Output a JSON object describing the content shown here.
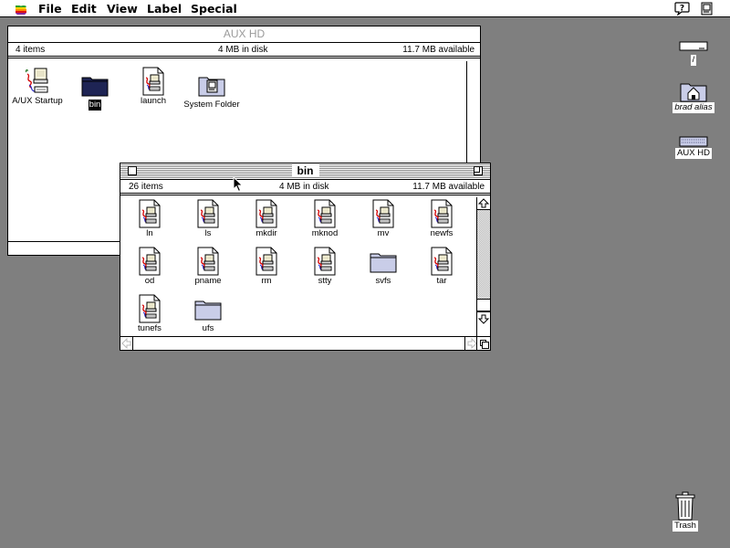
{
  "menubar": {
    "items": [
      "File",
      "Edit",
      "View",
      "Label",
      "Special"
    ]
  },
  "aux_window": {
    "title": "AUX HD",
    "items_count": "4 items",
    "disk_usage": "4 MB in disk",
    "available": "11.7 MB available",
    "icons": [
      {
        "label": "A/UX Startup",
        "icon": "application-icon",
        "selected": false
      },
      {
        "label": "bin",
        "icon": "folder-icon",
        "selected": true
      },
      {
        "label": "launch",
        "icon": "document-icon",
        "selected": false
      },
      {
        "label": "System Folder",
        "icon": "system-folder-icon",
        "selected": false
      }
    ]
  },
  "bin_window": {
    "title": "bin",
    "items_count": "26 items",
    "disk_usage": "4 MB in disk",
    "available": "11.7 MB available",
    "icons": [
      {
        "label": "ln",
        "icon": "document-icon"
      },
      {
        "label": "ls",
        "icon": "document-icon"
      },
      {
        "label": "mkdir",
        "icon": "document-icon"
      },
      {
        "label": "mknod",
        "icon": "document-icon"
      },
      {
        "label": "mv",
        "icon": "document-icon"
      },
      {
        "label": "newfs",
        "icon": "document-icon"
      },
      {
        "label": "od",
        "icon": "document-icon"
      },
      {
        "label": "pname",
        "icon": "document-icon"
      },
      {
        "label": "rm",
        "icon": "document-icon"
      },
      {
        "label": "stty",
        "icon": "document-icon"
      },
      {
        "label": "svfs",
        "icon": "folder-icon"
      },
      {
        "label": "tar",
        "icon": "document-icon"
      },
      {
        "label": "tunefs",
        "icon": "document-icon"
      },
      {
        "label": "ufs",
        "icon": "folder-icon"
      }
    ]
  },
  "desktop": {
    "root_label": "/",
    "alias_label": "brad alias",
    "disk_label": "AUX HD",
    "trash_label": "Trash"
  }
}
